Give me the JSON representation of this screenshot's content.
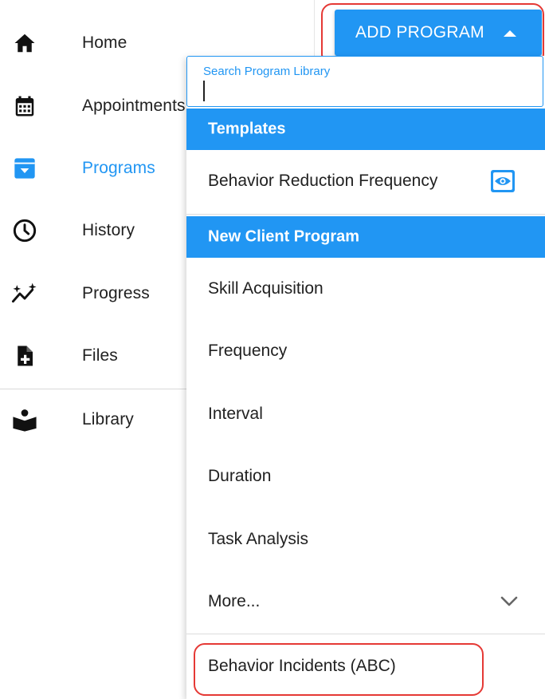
{
  "sidebar": {
    "items": [
      {
        "label": "Home",
        "icon": "home-icon",
        "active": false
      },
      {
        "label": "Appointments",
        "icon": "calendar-icon",
        "active": false
      },
      {
        "label": "Programs",
        "icon": "archive-box-icon",
        "active": true
      },
      {
        "label": "History",
        "icon": "clock-icon",
        "active": false
      },
      {
        "label": "Progress",
        "icon": "sparkle-trend-icon",
        "active": false
      },
      {
        "label": "Files",
        "icon": "file-add-icon",
        "active": false
      },
      {
        "label": "Library",
        "icon": "book-reader-icon",
        "active": false
      }
    ]
  },
  "toolbar": {
    "add_program_label": "ADD PROGRAM"
  },
  "dropdown": {
    "search": {
      "label": "Search Program Library",
      "value": ""
    },
    "templates_header": "Templates",
    "templates": [
      {
        "label": "Behavior Reduction Frequency",
        "icon": "eye-icon"
      }
    ],
    "new_program_header": "New Client Program",
    "program_types": [
      "Skill Acquisition",
      "Frequency",
      "Interval",
      "Duration",
      "Task Analysis"
    ],
    "more_label": "More...",
    "incidents_label": "Behavior Incidents (ABC)"
  },
  "colors": {
    "accent": "#2196f3",
    "highlight": "#e53935",
    "text": "#212121"
  }
}
